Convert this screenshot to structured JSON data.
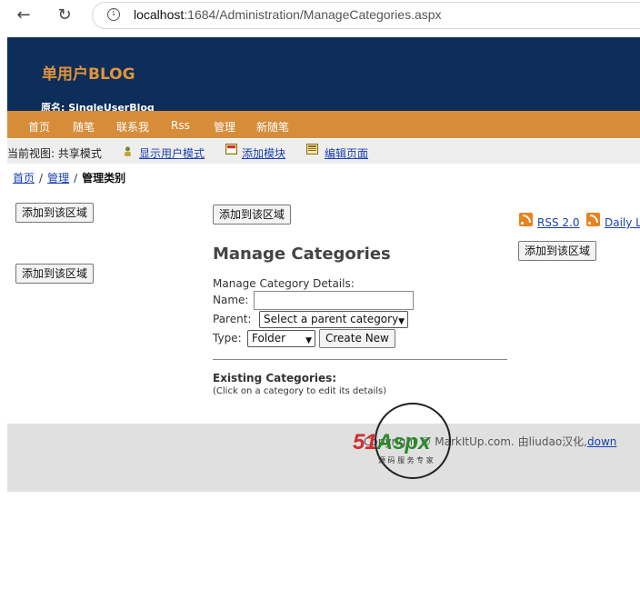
{
  "browser": {
    "url_host": "localhost",
    "url_rest": ":1684/Administration/ManageCategories.aspx"
  },
  "header": {
    "site_title": "单用户BLOG",
    "site_subtitle": "原名: SingleUserBlog"
  },
  "menu": {
    "items": [
      "首页",
      "随笔",
      "联系我",
      "Rss",
      "管理",
      "新随笔"
    ]
  },
  "viewbar": {
    "label": "当前视图: 共享模式",
    "links": [
      "显示用户模式",
      "添加模块",
      "编辑页面"
    ]
  },
  "breadcrumb": {
    "items": [
      "首页",
      "管理"
    ],
    "current": "管理类别"
  },
  "zones": {
    "add_label": "添加到该区域"
  },
  "manage": {
    "title": "Manage Categories",
    "details_label": "Manage Category Details:",
    "name_label": "Name:",
    "name_value": "",
    "parent_label": "Parent:",
    "parent_selected": "Select a parent category",
    "type_label": "Type:",
    "type_selected": "Folder",
    "create_label": "Create New",
    "existing_title": "Existing Categories:",
    "existing_note": "(Click on a category to edit its details)"
  },
  "rss": {
    "rss_label": "RSS 2.0",
    "daily_label": "Daily L"
  },
  "footer": {
    "copyright": "Copyright © MarkItUp.com.   由liudao汉化,",
    "download_link": "down"
  },
  "watermark": {
    "brand_red": "51",
    "brand_green": "Aspx",
    "tagline": "源 码 服 务 专 家"
  }
}
